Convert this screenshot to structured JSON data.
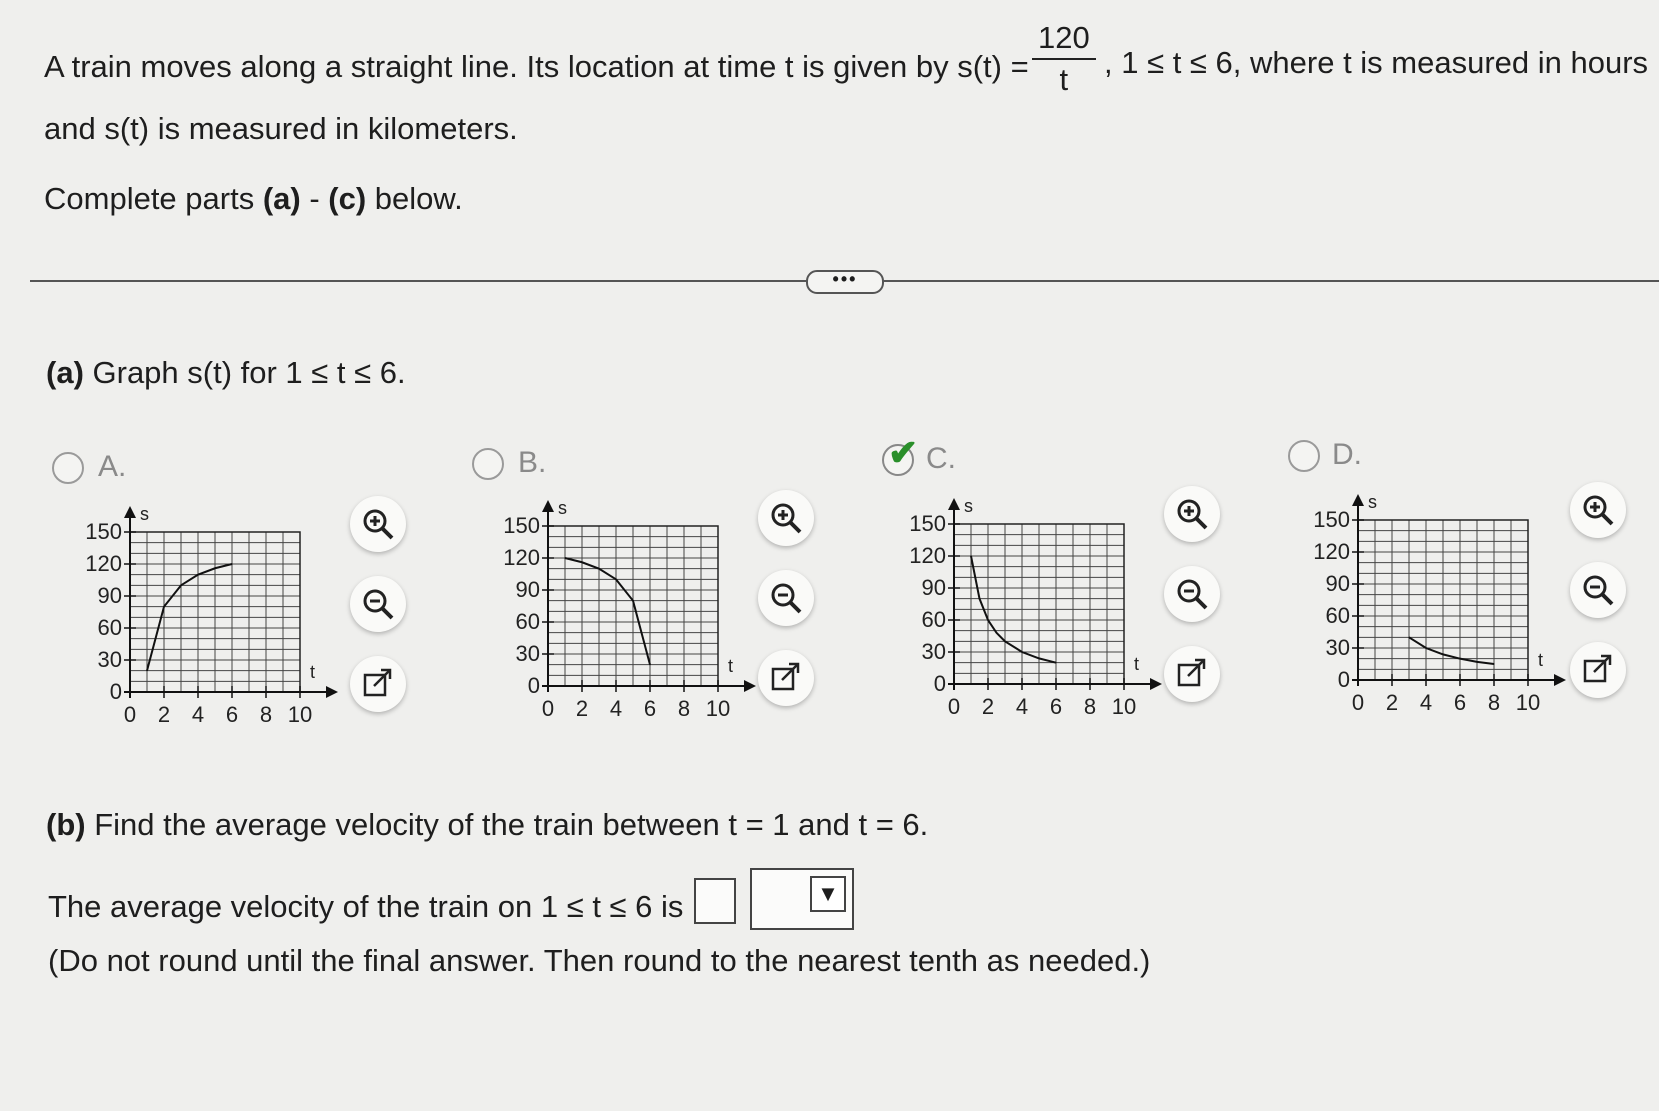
{
  "question": {
    "intro_before": "A train moves along a straight line. Its location at time t is given by s(t) =",
    "fraction_num": "120",
    "fraction_den": "t",
    "intro_after": ", 1 ≤ t ≤ 6, where t is measured in hours",
    "intro_line2": "and s(t) is measured in kilometers.",
    "instruction_prefix": "Complete parts ",
    "instruction_a": "(a)",
    "instruction_dash": " - ",
    "instruction_c": "(c)",
    "instruction_suffix": " below.",
    "more_label": "•••"
  },
  "part_a": {
    "label": "(a)",
    "text": " Graph s(t) for 1 ≤ t ≤ 6.",
    "options": [
      {
        "letter": "A.",
        "selected": false
      },
      {
        "letter": "B.",
        "selected": false
      },
      {
        "letter": "C.",
        "selected": true
      },
      {
        "letter": "D.",
        "selected": false
      }
    ],
    "graph_axis": {
      "y_label": "s",
      "x_label": "t",
      "y_ticks": [
        "150",
        "120",
        "90",
        "60",
        "30",
        "0"
      ],
      "x_ticks": [
        "0",
        "2",
        "4",
        "6",
        "8",
        "10"
      ],
      "ylim": [
        0,
        150
      ],
      "xlim": [
        0,
        10
      ]
    },
    "tools": [
      "zoom-in-icon",
      "zoom-out-icon",
      "open-external-icon"
    ]
  },
  "part_b": {
    "label": "(b)",
    "text": " Find the average velocity of the train between t = 1 and t = 6.",
    "answer_prefix": "The average velocity of the train on 1 ≤ t ≤ 6 is",
    "answer_value": "",
    "unit_value": "",
    "note": "(Do not round until the final answer. Then round to the nearest tenth as needed.)"
  },
  "chart_data": [
    {
      "type": "line",
      "option": "A",
      "x": [
        1,
        2,
        3,
        4,
        5,
        6
      ],
      "y": [
        20,
        80,
        100,
        110,
        116,
        120
      ],
      "xlim": [
        0,
        10
      ],
      "ylim": [
        0,
        150
      ]
    },
    {
      "type": "line",
      "option": "B",
      "x": [
        1,
        2,
        3,
        4,
        5,
        6
      ],
      "y": [
        120,
        116,
        110,
        100,
        80,
        20
      ],
      "xlim": [
        0,
        10
      ],
      "ylim": [
        0,
        150
      ]
    },
    {
      "type": "line",
      "option": "C",
      "x": [
        1,
        1.5,
        2,
        2.5,
        3,
        4,
        5,
        6
      ],
      "y": [
        120,
        80,
        60,
        48,
        40,
        30,
        24,
        20
      ],
      "xlim": [
        0,
        10
      ],
      "ylim": [
        0,
        150
      ]
    },
    {
      "type": "line",
      "option": "D",
      "x": [
        3,
        4,
        5,
        6,
        7,
        8
      ],
      "y": [
        40,
        30,
        24,
        20,
        17,
        15
      ],
      "xlim": [
        0,
        10
      ],
      "ylim": [
        0,
        150
      ]
    }
  ]
}
